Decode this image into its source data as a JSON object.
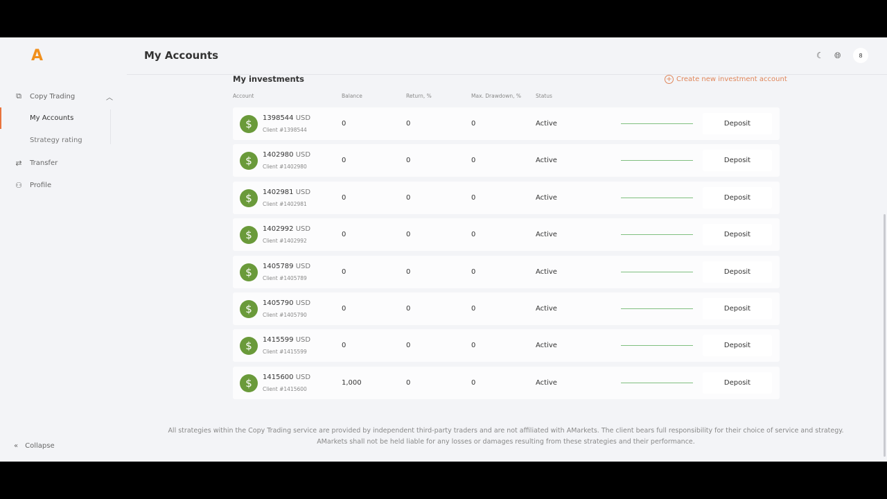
{
  "header": {
    "title": "My Accounts",
    "avatar": "8"
  },
  "sidebar": {
    "logo": "A",
    "items": [
      {
        "label": "Copy Trading",
        "icon": "copy-trading-icon"
      },
      {
        "label": "Transfer",
        "icon": "transfer-icon"
      },
      {
        "label": "Profile",
        "icon": "profile-icon"
      }
    ],
    "sub_items": [
      {
        "label": "My Accounts"
      },
      {
        "label": "Strategy rating"
      }
    ],
    "collapse": "Collapse"
  },
  "investments": {
    "title": "My investments",
    "create_label": "Create new investment account",
    "columns": [
      "Account",
      "Balance",
      "Return, %",
      "Max. Drawdown, %",
      "Status"
    ],
    "rows": [
      {
        "account": "1398544",
        "currency": "USD",
        "client": "Client #1398544",
        "balance": "0",
        "return": "0",
        "drawdown": "0",
        "status": "Active",
        "action": "Deposit"
      },
      {
        "account": "1402980",
        "currency": "USD",
        "client": "Client #1402980",
        "balance": "0",
        "return": "0",
        "drawdown": "0",
        "status": "Active",
        "action": "Deposit"
      },
      {
        "account": "1402981",
        "currency": "USD",
        "client": "Client #1402981",
        "balance": "0",
        "return": "0",
        "drawdown": "0",
        "status": "Active",
        "action": "Deposit"
      },
      {
        "account": "1402992",
        "currency": "USD",
        "client": "Client #1402992",
        "balance": "0",
        "return": "0",
        "drawdown": "0",
        "status": "Active",
        "action": "Deposit"
      },
      {
        "account": "1405789",
        "currency": "USD",
        "client": "Client #1405789",
        "balance": "0",
        "return": "0",
        "drawdown": "0",
        "status": "Active",
        "action": "Deposit"
      },
      {
        "account": "1405790",
        "currency": "USD",
        "client": "Client #1405790",
        "balance": "0",
        "return": "0",
        "drawdown": "0",
        "status": "Active",
        "action": "Deposit"
      },
      {
        "account": "1415599",
        "currency": "USD",
        "client": "Client #1415599",
        "balance": "0",
        "return": "0",
        "drawdown": "0",
        "status": "Active",
        "action": "Deposit"
      },
      {
        "account": "1415600",
        "currency": "USD",
        "client": "Client #1415600",
        "balance": "1,000",
        "return": "0",
        "drawdown": "0",
        "status": "Active",
        "action": "Deposit"
      }
    ]
  },
  "footer": {
    "disclaimer": "All strategies within the Copy Trading service are provided by independent third-party traders and are not affiliated with AMarkets. The client bears full responsibility for their choice of service and strategy. AMarkets shall not be held liable for any losses or damages resulting from these strategies and their performance."
  },
  "colors": {
    "accent": "#e8743e",
    "logo": "#f0901e",
    "account_icon": "#6a9a3a",
    "sparkline": "#7fbf7f"
  }
}
